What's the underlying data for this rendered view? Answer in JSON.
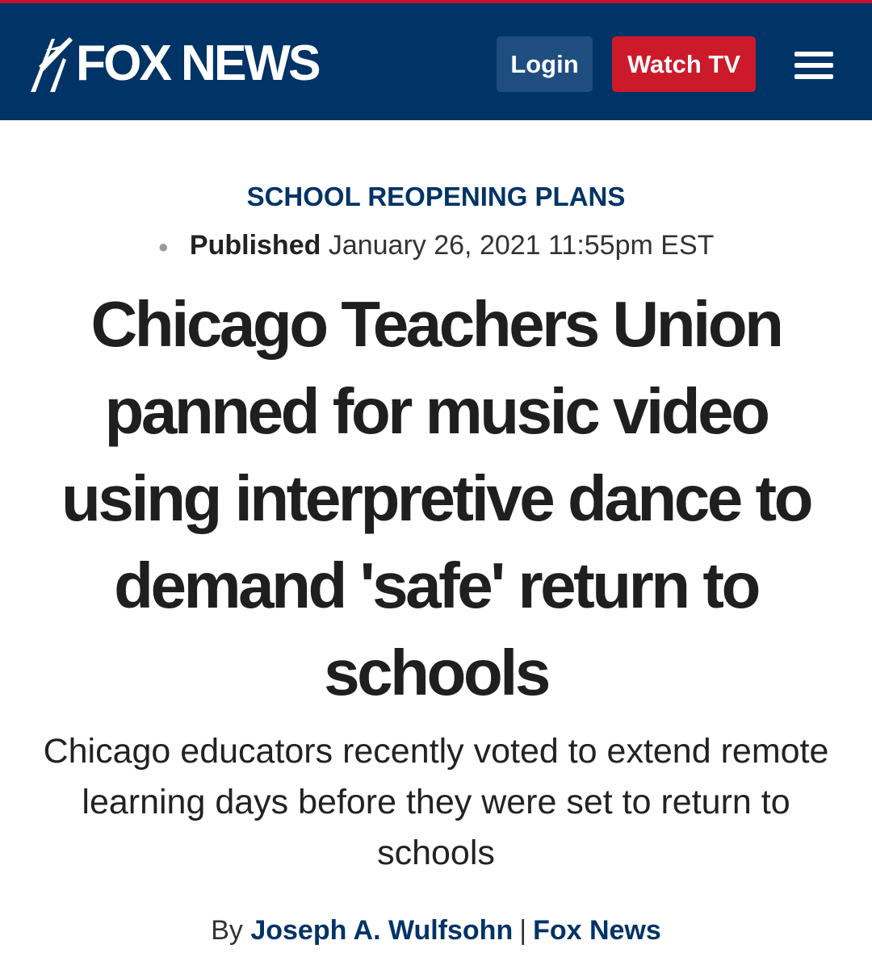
{
  "header": {
    "logo_text": "FOX NEWS",
    "login_label": "Login",
    "watch_label": "Watch TV",
    "menu_icon": "hamburger-menu-icon",
    "colors": {
      "background": "#003366",
      "top_accent": "#c8102e",
      "login_bg": "#1f4d80",
      "watch_bg": "#cc1a2b"
    }
  },
  "article": {
    "category": "SCHOOL REOPENING PLANS",
    "published_label": "Published",
    "published_date": "January 26, 2021 11:55pm EST",
    "headline": "Chicago Teachers Union panned for music video using interpretive dance to demand 'safe' return to schools",
    "deck": "Chicago educators recently voted to extend remote learning days before they were set to return to schools",
    "byline_prefix": "By",
    "author": "Joseph A. Wulfsohn",
    "byline_separator": "|",
    "outlet": "Fox News"
  }
}
